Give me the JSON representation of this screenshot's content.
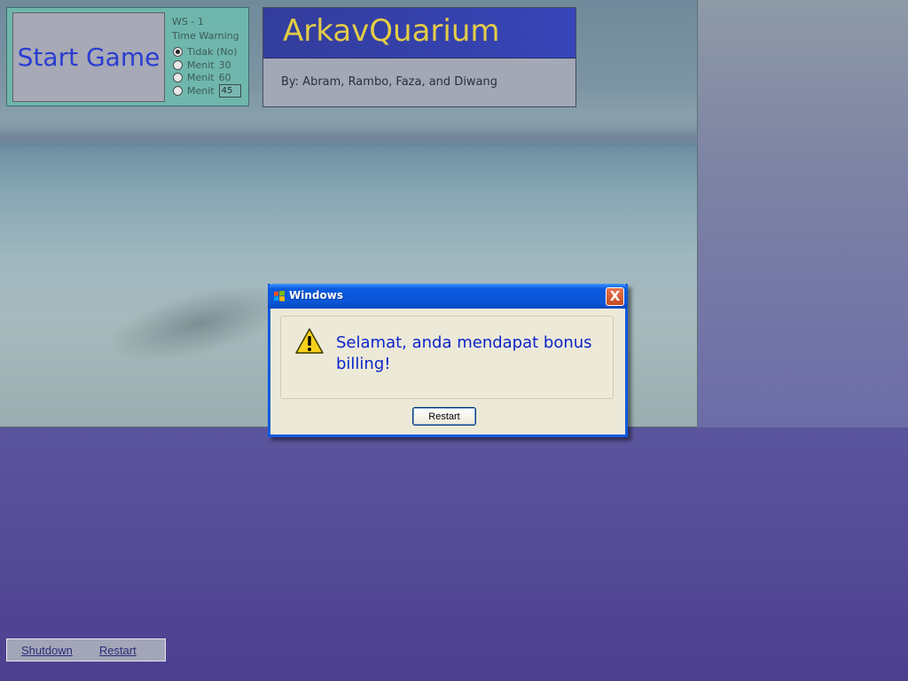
{
  "start_panel": {
    "start_button_label": "Start Game",
    "ws_label": "WS - 1",
    "time_warning_label": "Time Warning",
    "options": [
      {
        "label": "Tidak (No)",
        "checked": true
      },
      {
        "label": "Menit",
        "value": "30",
        "checked": false
      },
      {
        "label": "Menit",
        "value": "60",
        "checked": false
      },
      {
        "label": "Menit",
        "checked": false
      }
    ],
    "custom_minutes_value": "45"
  },
  "title_panel": {
    "title": "ArkavQuarium",
    "byline": "By: Abram, Rambo, Faza, and Diwang"
  },
  "dialog": {
    "title": "Windows",
    "close_label": "X",
    "message": "Selamat, anda mendapat bonus billing!",
    "button_label": "Restart",
    "icon": "warning-icon"
  },
  "bottom_bar": {
    "shutdown_label": "Shutdown",
    "restart_label": "Restart"
  },
  "colors": {
    "title_text": "#e3cc47",
    "start_text": "#2a3cd0",
    "dialog_message": "#0c24c9",
    "xp_blue": "#0a5adf"
  }
}
